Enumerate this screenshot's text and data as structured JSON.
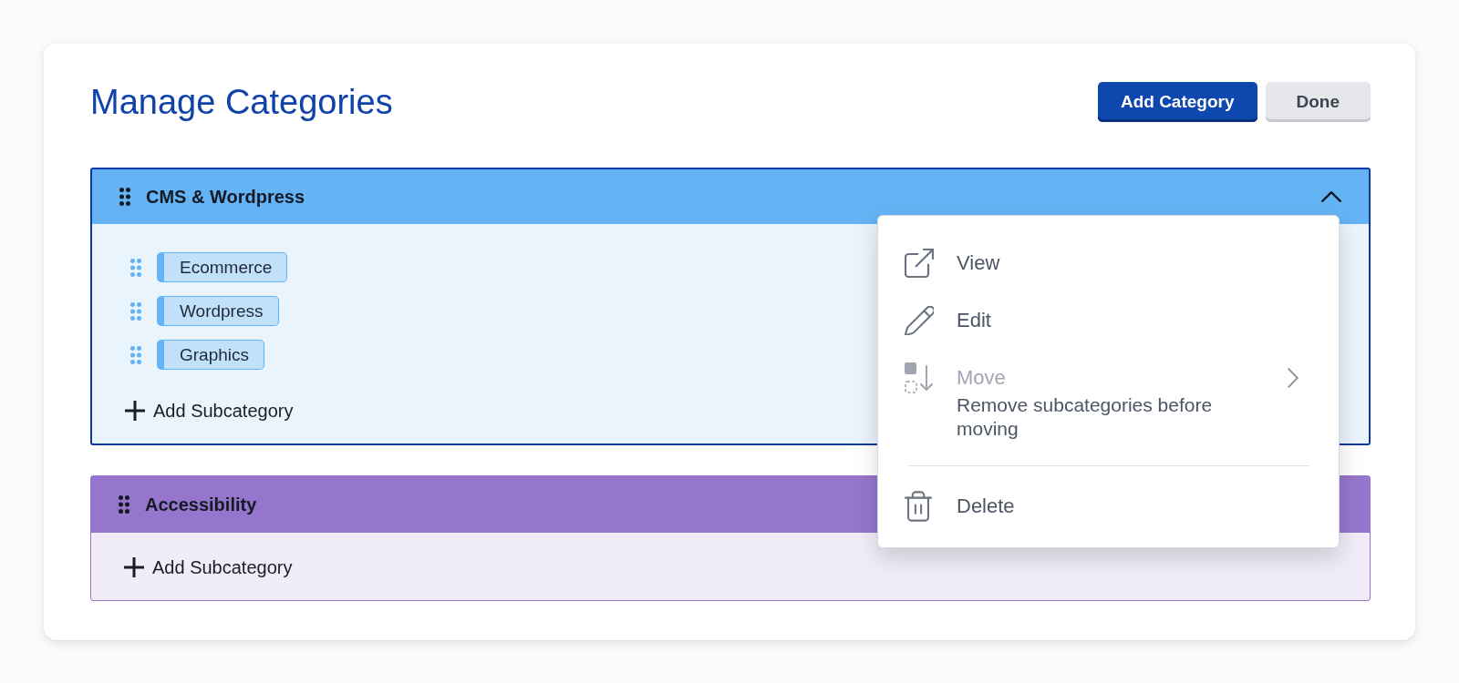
{
  "page": {
    "title": "Manage Categories"
  },
  "actions": [
    {
      "label": "Add Category",
      "kind": "primary"
    },
    {
      "label": "Done",
      "kind": "secondary"
    }
  ],
  "categories": [
    {
      "name": "CMS & Wordpress",
      "color": "#64b3f4",
      "selected": true,
      "expanded": true,
      "subcategories": [
        {
          "name": "Ecommerce"
        },
        {
          "name": "Wordpress"
        },
        {
          "name": "Graphics"
        }
      ],
      "add_label": "Add Subcategory"
    },
    {
      "name": "Accessibility",
      "color": "#9676cc",
      "selected": false,
      "add_label": "Add Subcategory"
    }
  ],
  "context_menu": {
    "groups": [
      {
        "items": [
          {
            "label": "View",
            "kind": "view",
            "disabled": false,
            "has_submenu": false
          },
          {
            "label": "Edit",
            "kind": "edit",
            "disabled": false,
            "has_submenu": false
          },
          {
            "label": "Move",
            "kind": "move",
            "disabled": true,
            "has_submenu": true,
            "note": "Remove subcategories before moving"
          }
        ]
      },
      {
        "items": [
          {
            "label": "Delete",
            "kind": "delete",
            "disabled": false,
            "has_submenu": false
          }
        ]
      }
    ]
  }
}
